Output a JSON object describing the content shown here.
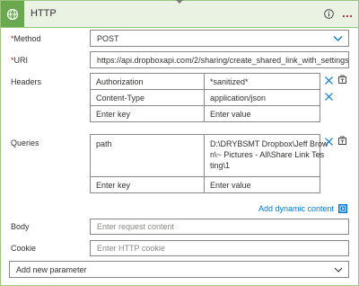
{
  "header": {
    "title": "HTTP",
    "icon": "http-globe-icon"
  },
  "method": {
    "label": "Method",
    "required_mark": "*",
    "value": "POST"
  },
  "uri": {
    "label": "URI",
    "required_mark": "*",
    "value": "https://api.dropboxapi.com/2/sharing/create_shared_link_with_settings"
  },
  "headers": {
    "label": "Headers",
    "rows": [
      {
        "key": "Authorization",
        "value": "*sanitized*"
      },
      {
        "key": "Content-Type",
        "value": "application/json"
      }
    ],
    "key_placeholder": "Enter key",
    "value_placeholder": "Enter value"
  },
  "queries": {
    "label": "Queries",
    "rows": [
      {
        "key": "path",
        "value_lines": [
          "D:\\DRYBSMT Dropbox\\Jeff Brow",
          "n\\~ Pictures - All\\Share Link Tes",
          "ting\\1"
        ]
      }
    ],
    "key_placeholder": "Enter key",
    "value_placeholder": "Enter value"
  },
  "add_dynamic_content": "Add dynamic content",
  "body": {
    "label": "Body",
    "placeholder": "Enter request content"
  },
  "cookie": {
    "label": "Cookie",
    "placeholder": "Enter HTTP cookie"
  },
  "add_param": {
    "placeholder": "Add new parameter"
  },
  "colors": {
    "header_bg": "#eaf2e3",
    "border": "#9bc57c",
    "accent": "#0078d4",
    "required": "#a4262c"
  }
}
